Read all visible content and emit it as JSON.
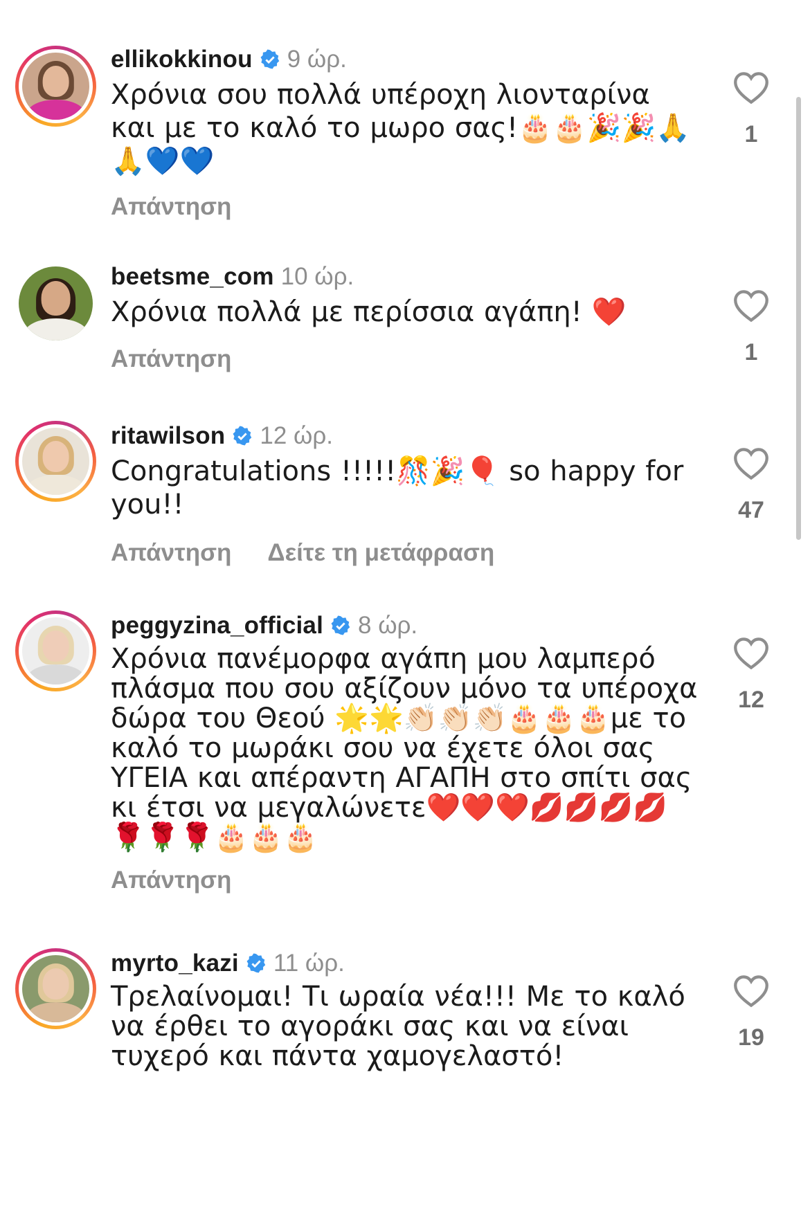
{
  "colors": {
    "verified": "#3897f0",
    "muted": "#8e8e8e",
    "text": "#1b1b1b"
  },
  "comments": [
    {
      "username": "ellikokkinou",
      "verified": true,
      "time": "9 ώρ.",
      "text": "Χρόνια σου πολλά υπέροχη λιονταρίνα και με το καλό το μωρο σας!🎂🎂🎉🎉🙏🙏💙💙",
      "reply": "Απάντηση",
      "likes": "1",
      "avatar_ring": true
    },
    {
      "username": "beetsme_com",
      "verified": false,
      "time": "10 ώρ.",
      "text": "Χρόνια πολλά με περίσσια αγάπη! ❤️",
      "reply": "Απάντηση",
      "likes": "1",
      "avatar_ring": false
    },
    {
      "username": "ritawilson",
      "verified": true,
      "time": "12 ώρ.",
      "text": "Congratulations !!!!!🎊🎉🎈  so happy for you!!",
      "reply": "Απάντηση",
      "translate": "Δείτε τη μετάφραση",
      "likes": "47",
      "avatar_ring": true
    },
    {
      "username": "peggyzina_official",
      "verified": true,
      "time": "8 ώρ.",
      "text": "Χρόνια πανέμορφα αγάπη μου λαμπερό πλάσμα που σου αξίζουν μόνο τα υπέροχα δώρα του Θεού 🌟🌟👏🏻👏🏻👏🏻🎂🎂🎂με το καλό το μωράκι σου να έχετε όλοι σας ΥΓΕΙΑ και απέραντη ΑΓΑΠΗ στο σπίτι σας κι έτσι να μεγαλώνετε❤️❤️❤️💋💋💋💋🌹🌹🌹🎂🎂🎂",
      "reply": "Απάντηση",
      "likes": "12",
      "avatar_ring": true
    },
    {
      "username": "myrto_kazi",
      "verified": true,
      "time": "11 ώρ.",
      "text": "Τρελαίνομαι! Τι ωραία νέα!!! Με το καλό να έρθει το αγοράκι σας και να είναι τυχερό και πάντα χαμογελαστό!",
      "reply": "Απάντηση",
      "likes": "19",
      "avatar_ring": true
    }
  ]
}
